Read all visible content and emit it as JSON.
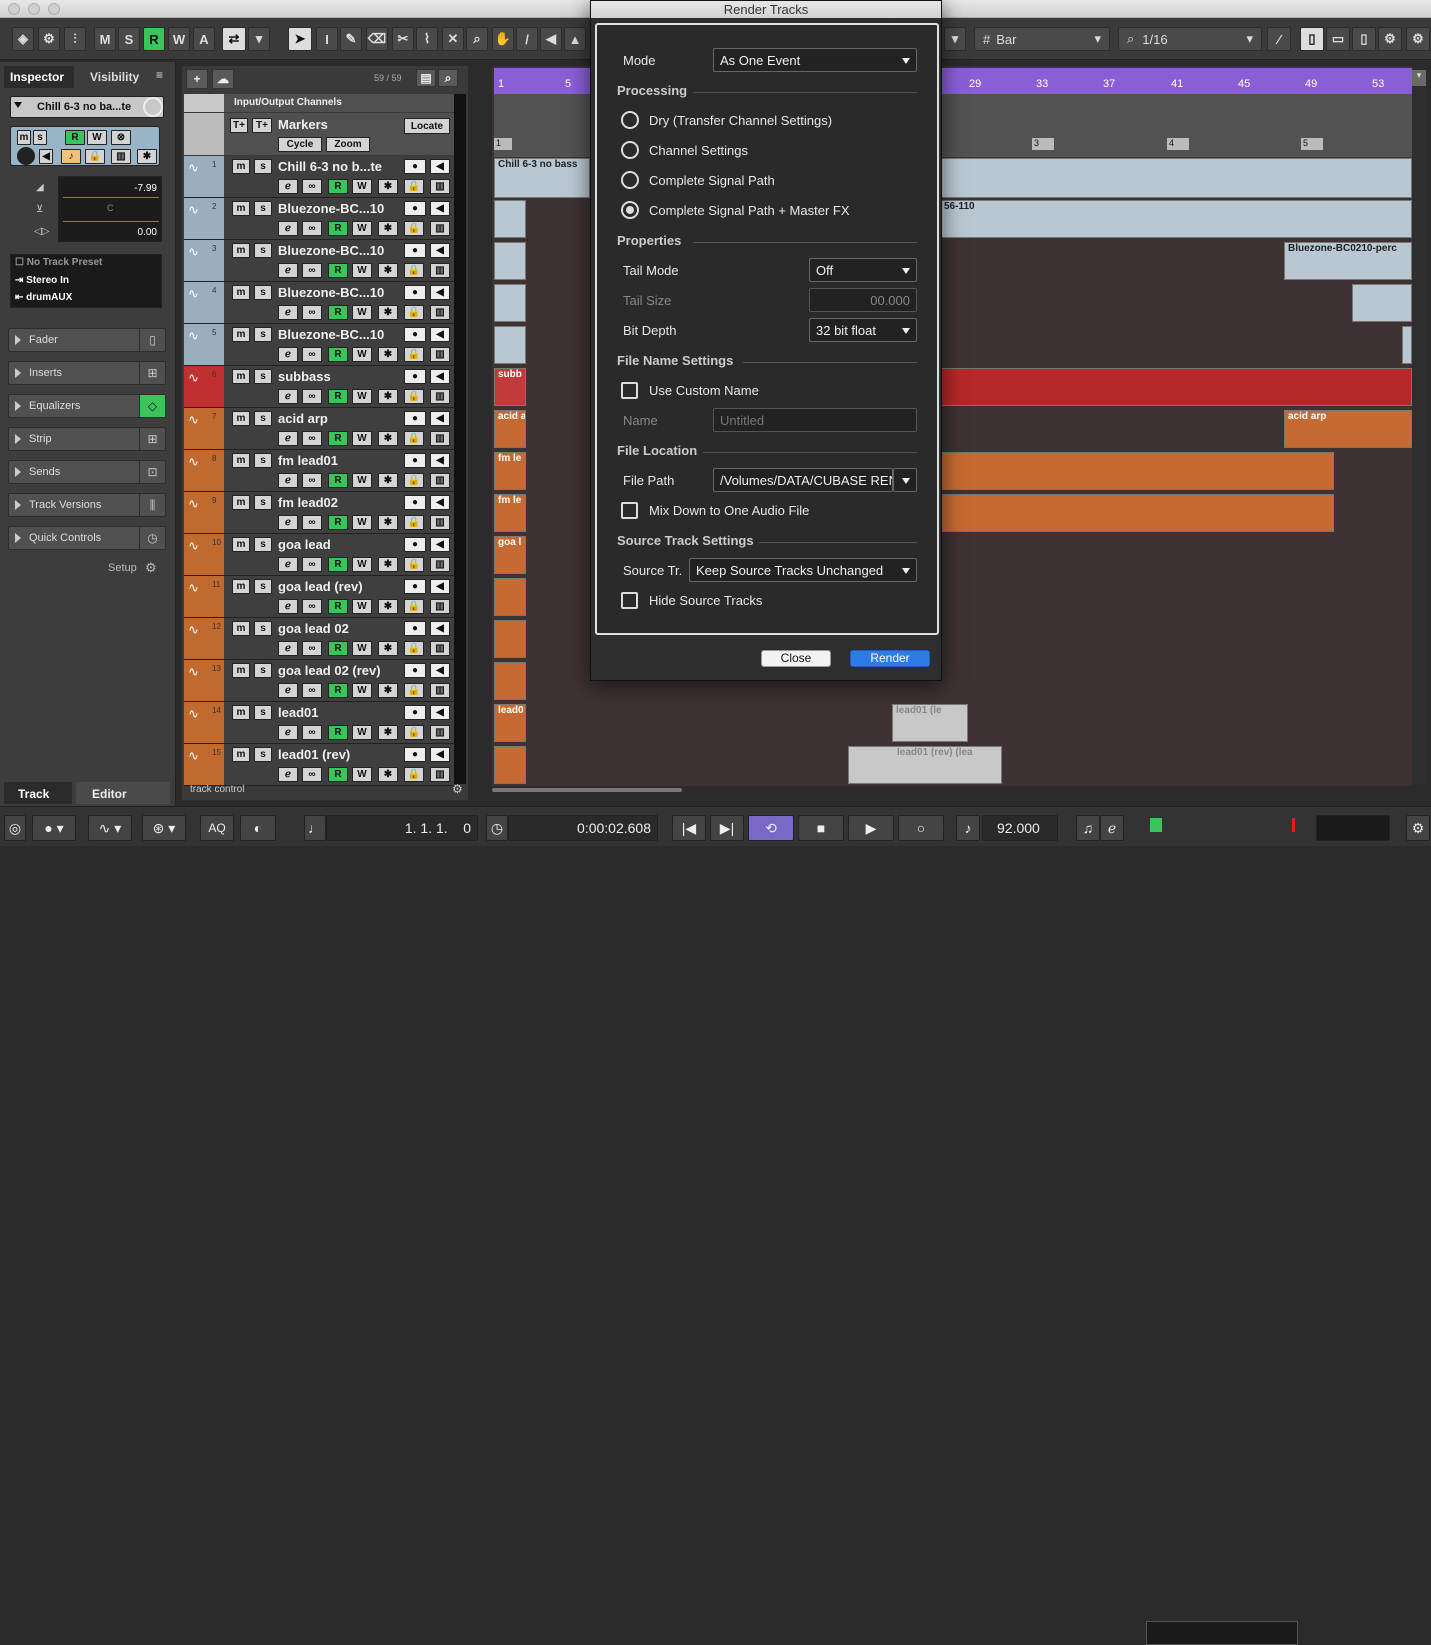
{
  "window": {
    "title": "Render Tracks"
  },
  "toolbar": {
    "modes": [
      "M",
      "S",
      "R",
      "W",
      "A"
    ],
    "snap_type": "Bar",
    "quantize": "1/16"
  },
  "inspector": {
    "tab_inspector": "Inspector",
    "tab_visibility": "Visibility",
    "track_name": "Chill 6-3 no ba...te",
    "volume": "-7.99",
    "pan": "C",
    "delay": "0.00",
    "routing": [
      "No Track Preset",
      "Stereo In",
      "drumAUX"
    ],
    "sections": [
      "Fader",
      "Inserts",
      "Equalizers",
      "Strip",
      "Sends",
      "Track Versions",
      "Quick Controls"
    ],
    "setup": "Setup",
    "bottom_tab_track": "Track",
    "bottom_tab_editor": "Editor"
  },
  "tracklist": {
    "count": "59 / 59",
    "io_label": "Input/Output Channels",
    "markers_label": "Markers",
    "locate": "Locate",
    "cycle": "Cycle",
    "zoom": "Zoom",
    "footer": "track control",
    "tracks": [
      {
        "num": "1",
        "name": "Chill 6-3 no b...te",
        "color": "#9aaebe"
      },
      {
        "num": "2",
        "name": "Bluezone-BC...10",
        "color": "#9aaebe"
      },
      {
        "num": "3",
        "name": "Bluezone-BC...10",
        "color": "#9aaebe"
      },
      {
        "num": "4",
        "name": "Bluezone-BC...10",
        "color": "#9aaebe"
      },
      {
        "num": "5",
        "name": "Bluezone-BC...10",
        "color": "#9aaebe"
      },
      {
        "num": "6",
        "name": "subbass",
        "color": "#c03030"
      },
      {
        "num": "7",
        "name": "acid arp",
        "color": "#c06a30"
      },
      {
        "num": "8",
        "name": "fm lead01",
        "color": "#c06a30"
      },
      {
        "num": "9",
        "name": "fm lead02",
        "color": "#c06a30"
      },
      {
        "num": "10",
        "name": "goa lead",
        "color": "#c06a30"
      },
      {
        "num": "11",
        "name": "goa lead (rev)",
        "color": "#c06a30"
      },
      {
        "num": "12",
        "name": "goa lead 02",
        "color": "#c06a30"
      },
      {
        "num": "13",
        "name": "goa lead 02 (rev)",
        "color": "#c06a30"
      },
      {
        "num": "14",
        "name": "lead01",
        "color": "#c06a30"
      },
      {
        "num": "15",
        "name": "lead01 (rev)",
        "color": "#c06a30"
      }
    ]
  },
  "ruler": [
    "1",
    "5",
    "29",
    "33",
    "37",
    "41",
    "45",
    "49",
    "53"
  ],
  "markers": [
    "1",
    "3",
    "4",
    "5"
  ],
  "events": {
    "chill": "Chill 6-3 no bass",
    "bluezone2": "56-110",
    "bluezone3": "Bluezone-BC0210-perc",
    "subbass": "subb",
    "acid": "acid a",
    "acid2": "acid arp",
    "fm1": "fm le",
    "fm2": "fm le",
    "goa": "goa l",
    "lead01": "lead0",
    "lead01_ghost": "lead01 (le",
    "lead01rev_ghost": "lead01 (rev) (lea"
  },
  "dialog": {
    "mode_label": "Mode",
    "mode_value": "As One Event",
    "processing_heading": "Processing",
    "processing_options": [
      "Dry (Transfer Channel Settings)",
      "Channel Settings",
      "Complete Signal Path",
      "Complete Signal Path + Master FX"
    ],
    "properties_heading": "Properties",
    "tail_mode_label": "Tail Mode",
    "tail_mode_value": "Off",
    "tail_size_label": "Tail Size",
    "tail_size_value": "00.000",
    "bit_depth_label": "Bit Depth",
    "bit_depth_value": "32 bit float",
    "file_name_heading": "File Name Settings",
    "use_custom_name": "Use Custom Name",
    "name_label": "Name",
    "name_placeholder": "Untitled",
    "file_location_heading": "File Location",
    "file_path_label": "File Path",
    "file_path_value": "/Volumes/DATA/CUBASE REN",
    "mix_down": "Mix Down to One Audio File",
    "source_heading": "Source Track Settings",
    "source_label": "Source Tr.",
    "source_value": "Keep Source Tracks Unchanged",
    "hide_source": "Hide Source Tracks",
    "close": "Close",
    "render": "Render"
  },
  "transport": {
    "position": "1. 1. 1.    0",
    "time": "0:00:02.608",
    "tempo": "92.000",
    "aq": "AQ"
  }
}
